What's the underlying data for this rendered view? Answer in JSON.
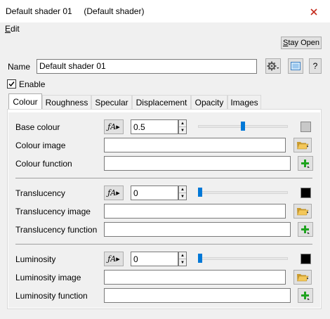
{
  "window": {
    "title": "Default shader 01     (Default shader)",
    "close_glyph": "×"
  },
  "menu": {
    "edit": "Edit"
  },
  "toolbar": {
    "stay_open": "Stay Open"
  },
  "name": {
    "label": "Name",
    "value": "Default shader 01"
  },
  "enable": {
    "label": "Enable",
    "checked": true
  },
  "help": {
    "label": "?"
  },
  "tabs": [
    {
      "label": "Colour",
      "active": true
    },
    {
      "label": "Roughness"
    },
    {
      "label": "Specular"
    },
    {
      "label": "Displacement"
    },
    {
      "label": "Opacity"
    },
    {
      "label": "Images"
    }
  ],
  "colour_tab": {
    "base_colour": {
      "label": "Base colour",
      "value": "0.5",
      "slider": 0.5,
      "swatch": "#c8c8c8"
    },
    "colour_image": {
      "label": "Colour image",
      "value": ""
    },
    "colour_function": {
      "label": "Colour function",
      "value": ""
    },
    "translucency": {
      "label": "Translucency",
      "value": "0",
      "slider": 0.0,
      "swatch": "#000000"
    },
    "translucency_image": {
      "label": "Translucency image",
      "value": ""
    },
    "translucency_function": {
      "label": "Translucency function",
      "value": ""
    },
    "luminosity": {
      "label": "Luminosity",
      "value": "0",
      "slider": 0.0,
      "swatch": "#000000"
    },
    "luminosity_image": {
      "label": "Luminosity image",
      "value": ""
    },
    "luminosity_function": {
      "label": "Luminosity function",
      "value": ""
    }
  },
  "colors": {
    "accent": "#0078d7",
    "folder": "#e8b64a",
    "plus": "#1fa31f"
  },
  "icons": {
    "fx": "function-icon",
    "folder": "folder-open-icon",
    "plus": "add-icon",
    "gear": "gear-icon",
    "preview": "preview-icon"
  }
}
